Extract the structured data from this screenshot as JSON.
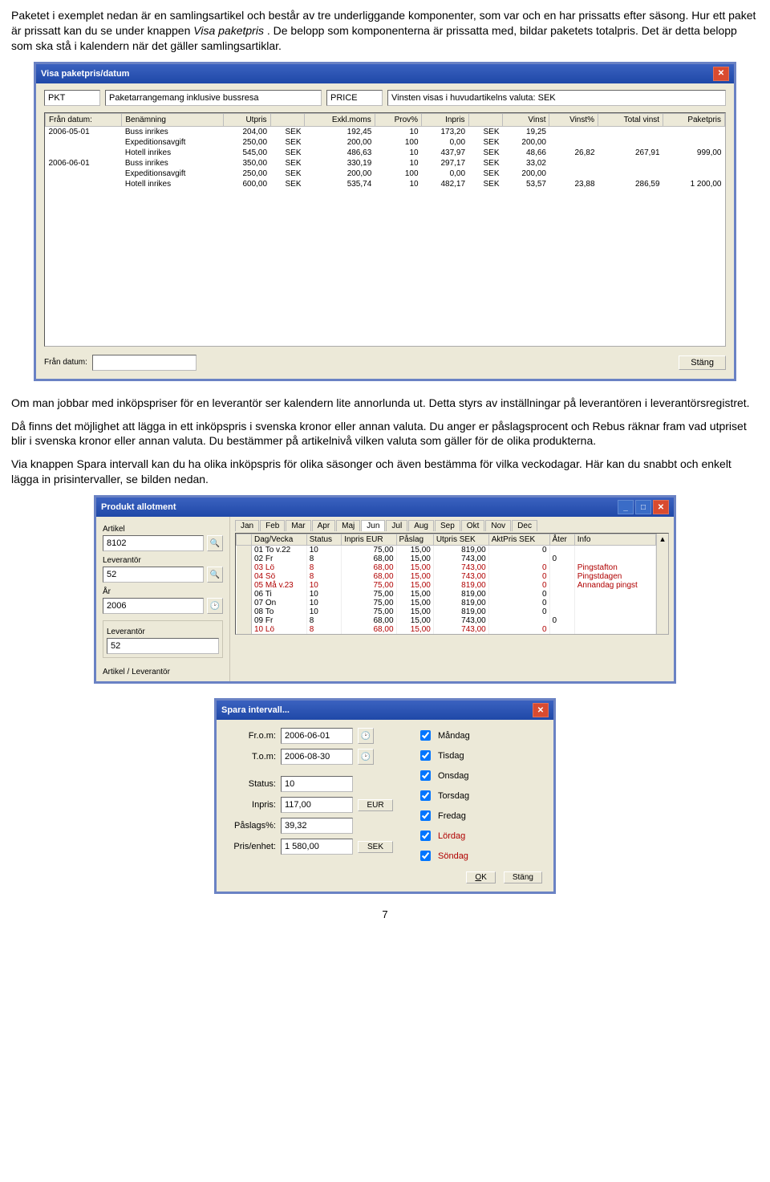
{
  "para1a": "Paketet i exemplet nedan är en samlingsartikel och består av tre underliggande komponenter, som var och en har prissatts efter säsong. Hur ett paket är prissatt kan du se under knappen ",
  "para1b": "Visa paketpris",
  "para1c": ". De belopp som komponenterna är prissatta med, bildar paketets totalpris. Det är detta belopp som ska stå i kalendern när det gäller samlingsartiklar.",
  "para2": "Om man jobbar med inköpspriser för en leverantör ser kalendern lite annorlunda ut. Detta styrs av inställningar på leverantören i leverantörsregistret.",
  "para3": "Då finns det möjlighet att lägga in ett inköpspris i svenska kronor eller annan valuta. Du anger er påslagsprocent och Rebus räknar fram vad utpriset blir i svenska kronor eller annan valuta. Du bestämmer på artikelnivå vilken valuta som gäller för de olika produkterna.",
  "para4": "Via knappen Spara intervall kan du ha olika inköpspris för olika säsonger och även bestämma för vilka veckodagar. Här kan du snabbt och enkelt lägga in prisintervaller, se bilden nedan.",
  "pagenum": "7",
  "w1": {
    "title": "Visa paketpris/datum",
    "top": {
      "code": "PKT",
      "name": "Paketarrangemang inklusive bussresa",
      "pricelbl": "PRICE",
      "note": "Vinsten visas i huvudartikelns valuta: SEK"
    },
    "headers": [
      "Från datum:",
      "Benämning",
      "Utpris",
      "",
      "Exkl.moms",
      "Prov%",
      "Inpris",
      "",
      "Vinst",
      "Vinst%",
      "Total vinst",
      "Paketpris"
    ],
    "rows": [
      [
        "2006-05-01",
        "Buss inrikes",
        "204,00",
        "SEK",
        "192,45",
        "10",
        "173,20",
        "SEK",
        "19,25",
        "",
        "",
        ""
      ],
      [
        "",
        "Expeditionsavgift",
        "250,00",
        "SEK",
        "200,00",
        "100",
        "0,00",
        "SEK",
        "200,00",
        "",
        "",
        ""
      ],
      [
        "",
        "Hotell inrikes",
        "545,00",
        "SEK",
        "486,63",
        "10",
        "437,97",
        "SEK",
        "48,66",
        "26,82",
        "267,91",
        "999,00"
      ],
      [
        "2006-06-01",
        "Buss inrikes",
        "350,00",
        "SEK",
        "330,19",
        "10",
        "297,17",
        "SEK",
        "33,02",
        "",
        "",
        ""
      ],
      [
        "",
        "Expeditionsavgift",
        "250,00",
        "SEK",
        "200,00",
        "100",
        "0,00",
        "SEK",
        "200,00",
        "",
        "",
        ""
      ],
      [
        "",
        "Hotell inrikes",
        "600,00",
        "SEK",
        "535,74",
        "10",
        "482,17",
        "SEK",
        "53,57",
        "23,88",
        "286,59",
        "1 200,00"
      ]
    ],
    "bottom": {
      "fromlabel": "Från datum:",
      "close": "Stäng"
    }
  },
  "w2": {
    "title": "Produkt allotment",
    "left": {
      "artikel_lbl": "Artikel",
      "artikel": "8102",
      "lev_lbl": "Leverantör",
      "lev": "52",
      "ar_lbl": "År",
      "ar": "2006",
      "lev2_lbl": "Leverantör",
      "lev2": "52",
      "artlev_lbl": "Artikel / Leverantör"
    },
    "tabs": [
      "Jan",
      "Feb",
      "Mar",
      "Apr",
      "Maj",
      "Jun",
      "Jul",
      "Aug",
      "Sep",
      "Okt",
      "Nov",
      "Dec"
    ],
    "active_tab": 5,
    "headers": [
      "Dag/Vecka",
      "Status",
      "Inpris EUR",
      "Påslag",
      "Utpris SEK",
      "AktPris SEK",
      "Åter",
      "Info"
    ],
    "rows": [
      {
        "cells": [
          "01 To  v.22",
          "10",
          "75,00",
          "15,00",
          "819,00",
          "0",
          "",
          ""
        ],
        "red": false
      },
      {
        "cells": [
          "02 Fr",
          "8",
          "68,00",
          "15,00",
          "743,00",
          "",
          "0",
          ""
        ],
        "red": false
      },
      {
        "cells": [
          "03 Lö",
          "8",
          "68,00",
          "15,00",
          "743,00",
          "0",
          "",
          "Pingstafton"
        ],
        "red": true
      },
      {
        "cells": [
          "04 Sö",
          "8",
          "68,00",
          "15,00",
          "743,00",
          "0",
          "",
          "Pingstdagen"
        ],
        "red": true
      },
      {
        "cells": [
          "05 Må  v.23",
          "10",
          "75,00",
          "15,00",
          "819,00",
          "0",
          "",
          "Annandag pingst"
        ],
        "red": true
      },
      {
        "cells": [
          "06 Ti",
          "10",
          "75,00",
          "15,00",
          "819,00",
          "0",
          "",
          ""
        ],
        "red": false
      },
      {
        "cells": [
          "07 On",
          "10",
          "75,00",
          "15,00",
          "819,00",
          "0",
          "",
          ""
        ],
        "red": false
      },
      {
        "cells": [
          "08 To",
          "10",
          "75,00",
          "15,00",
          "819,00",
          "0",
          "",
          ""
        ],
        "red": false
      },
      {
        "cells": [
          "09 Fr",
          "8",
          "68,00",
          "15,00",
          "743,00",
          "",
          "0",
          ""
        ],
        "red": false
      },
      {
        "cells": [
          "10 Lö",
          "8",
          "68,00",
          "15,00",
          "743,00",
          "0",
          "",
          ""
        ],
        "red": true
      }
    ]
  },
  "w3": {
    "title": "Spara intervall...",
    "rows": {
      "from_lbl": "Fr.o.m:",
      "from": "2006-06-01",
      "to_lbl": "T.o.m:",
      "to": "2006-08-30",
      "status_lbl": "Status:",
      "status": "10",
      "inpris_lbl": "Inpris:",
      "inpris": "117,00",
      "inpris_unit": "EUR",
      "paslag_lbl": "Påslags%:",
      "paslag": "39,32",
      "pris_lbl": "Pris/enhet:",
      "pris": "1 580,00",
      "pris_unit": "SEK"
    },
    "days": [
      {
        "label": "Måndag",
        "red": false
      },
      {
        "label": "Tisdag",
        "red": false
      },
      {
        "label": "Onsdag",
        "red": false
      },
      {
        "label": "Torsdag",
        "red": false
      },
      {
        "label": "Fredag",
        "red": false
      },
      {
        "label": "Lördag",
        "red": true
      },
      {
        "label": "Söndag",
        "red": true
      }
    ],
    "ok": "OK",
    "close": "Stäng"
  }
}
